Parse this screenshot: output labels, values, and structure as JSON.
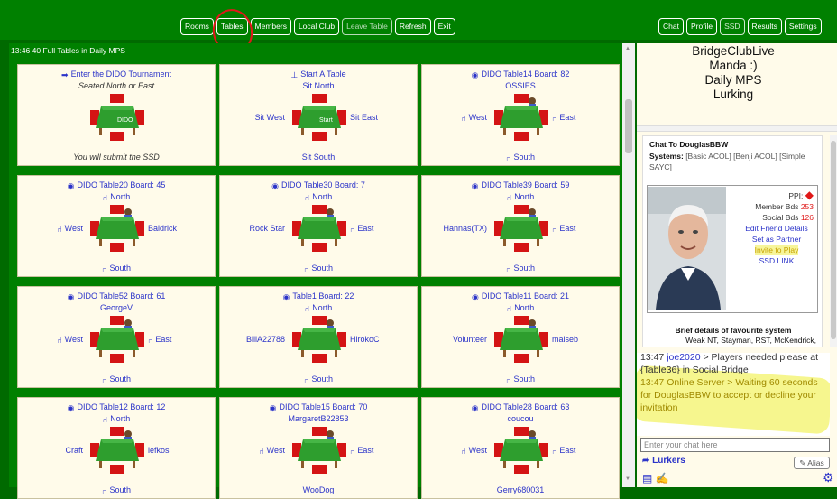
{
  "nav_left": [
    "Rooms",
    "Tables",
    "Members",
    "Local Club",
    "Leave Table",
    "Refresh",
    "Exit"
  ],
  "nav_right": [
    "Chat",
    "Profile",
    "SSD",
    "Results",
    "Settings"
  ],
  "tables_header": "13:46 40 Full Tables in Daily MPS",
  "tiles": [
    {
      "top": "Enter the DIDO Tournament",
      "sub": "Seated North or East",
      "west": "",
      "east": "",
      "bottom": "You will submit the SSD",
      "icon": "enter-icon",
      "style": "enter"
    },
    {
      "top": "Start A Table",
      "sub": "Sit North",
      "west": "Sit West",
      "east": "Sit East",
      "bottom": "Sit South",
      "icon": "start-table-icon",
      "style": "start"
    },
    {
      "top": "DIDO Table14 Board: 82",
      "sub": "OSSIES",
      "west": "West",
      "east": "East",
      "bottom": "South",
      "icon": "eye-icon"
    },
    {
      "top": "DIDO Table20 Board: 45",
      "sub": "North",
      "west": "West",
      "east": "Baldrick",
      "bottom": "South",
      "icon": "eye-icon"
    },
    {
      "top": "DIDO Table30 Board: 7",
      "sub": "North",
      "west": "Rock Star",
      "east": "East",
      "bottom": "South",
      "icon": "eye-icon"
    },
    {
      "top": "DIDO Table39 Board: 59",
      "sub": "North",
      "west": "Hannas(TX)",
      "east": "East",
      "bottom": "South",
      "icon": "eye-icon"
    },
    {
      "top": "DIDO Table52 Board: 61",
      "sub": "GeorgeV",
      "west": "West",
      "east": "East",
      "bottom": "South",
      "icon": "eye-icon"
    },
    {
      "top": "Table1 Board: 22",
      "sub": "North",
      "west": "BillA22788",
      "east": "HirokoC",
      "bottom": "South",
      "icon": "eye-icon"
    },
    {
      "top": "DIDO Table11 Board: 21",
      "sub": "North",
      "west": "Volunteer",
      "east": "maiseb",
      "bottom": "South",
      "icon": "eye-icon"
    },
    {
      "top": "DIDO Table12 Board: 12",
      "sub": "North",
      "west": "Craft",
      "east": "lefkos",
      "bottom": "South",
      "icon": "eye-icon"
    },
    {
      "top": "DIDO Table15 Board: 70",
      "sub": "MargaretB22853",
      "west": "West",
      "east": "East",
      "bottom": "WooDog",
      "icon": "eye-icon"
    },
    {
      "top": "DIDO Table28 Board: 63",
      "sub": "coucou",
      "west": "West",
      "east": "East",
      "bottom": "Gerry680031",
      "icon": "eye-icon"
    }
  ],
  "right_title": [
    "BridgeClubLive",
    "Manda :)",
    "Daily MPS",
    "Lurking"
  ],
  "profile": {
    "chat_to_label": "Chat To",
    "chat_to_user": "DouglasBBW",
    "systems_label": "Systems:",
    "systems": "[Basic ACOL]   [Benji ACOL] [Simple SAYC]",
    "ppi_label": "PPI:",
    "member_bds_label": "Member Bds",
    "member_bds": "253",
    "social_bds_label": "Social Bds",
    "social_bds": "126",
    "links": [
      "Edit Friend Details",
      "Set as Partner"
    ],
    "invite": "Invite to Play",
    "ssd_link": "SSD LINK",
    "brief_title": "Brief details of favourite system",
    "brief_text": "Weak NT, Stayman, RST, McKendrick,"
  },
  "chat": {
    "msg1_time": "13:47",
    "msg1_user": "joe2020",
    "msg1_text": " > Players needed please at {Table36} in Social Bridge",
    "msg2": "13:47 Online Server > Waiting 60 seconds for DouglasBBW to accept or decline your invitation",
    "placeholder": "Enter your chat here",
    "lurkers": "Lurkers",
    "alias": "Alias"
  }
}
